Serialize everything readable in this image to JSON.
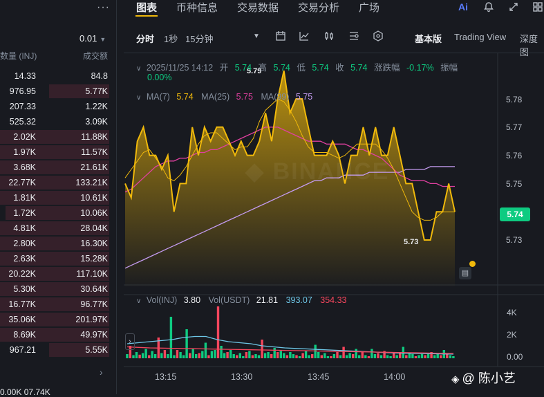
{
  "orderbook": {
    "menu_icon": "more-dots-icon",
    "step_value": "0.01",
    "col_qty": "数量 (INJ)",
    "col_total": "成交额",
    "rows": [
      {
        "q": "14.33",
        "t": "84.8",
        "depth": 0
      },
      {
        "q": "976.95",
        "t": "5.77K",
        "depth": 0.55
      },
      {
        "q": "207.33",
        "t": "1.22K",
        "depth": 0
      },
      {
        "q": "525.32",
        "t": "3.09K",
        "depth": 0
      },
      {
        "q": "2.02K",
        "t": "11.88K",
        "depth": 1
      },
      {
        "q": "1.97K",
        "t": "11.57K",
        "depth": 1
      },
      {
        "q": "3.68K",
        "t": "21.61K",
        "depth": 1
      },
      {
        "q": "22.77K",
        "t": "133.21K",
        "depth": 1
      },
      {
        "q": "1.81K",
        "t": "10.61K",
        "depth": 1
      },
      {
        "q": "1.72K",
        "t": "10.06K",
        "depth": 0.95
      },
      {
        "q": "4.81K",
        "t": "28.04K",
        "depth": 1
      },
      {
        "q": "2.80K",
        "t": "16.30K",
        "depth": 1
      },
      {
        "q": "2.63K",
        "t": "15.28K",
        "depth": 1
      },
      {
        "q": "20.22K",
        "t": "117.10K",
        "depth": 1
      },
      {
        "q": "5.30K",
        "t": "30.64K",
        "depth": 1
      },
      {
        "q": "16.77K",
        "t": "96.77K",
        "depth": 1
      },
      {
        "q": "35.06K",
        "t": "201.97K",
        "depth": 1
      },
      {
        "q": "8.69K",
        "t": "49.97K",
        "depth": 1
      },
      {
        "q": "967.21",
        "t": "5.55K",
        "depth": 0.55
      }
    ],
    "bottom_row": "0.00K    07.74K"
  },
  "tabs": [
    "图表",
    "币种信息",
    "交易数据",
    "交易分析",
    "广场"
  ],
  "active_tab": "图表",
  "top_icons": [
    "ai-icon",
    "bell-icon",
    "expand-icon",
    "layout-icon"
  ],
  "toolbar": {
    "intervals": [
      "分时",
      "1秒",
      "15分钟"
    ],
    "active_interval": "分时",
    "views": [
      "基本版",
      "Trading View",
      "深度图"
    ],
    "active_view": "基本版"
  },
  "ohlc": {
    "datetime": "2025/11/25 14:12",
    "open_label": "开",
    "open": "5.74",
    "high_label": "高",
    "high": "5.74",
    "low_label": "低",
    "low": "5.74",
    "close_label": "收",
    "close": "5.74",
    "change_label": "涨跌幅",
    "change": "-0.17%",
    "amp_label": "振幅",
    "amp": "0.00%"
  },
  "ma": {
    "ma7_label": "MA(7)",
    "ma7": "5.74",
    "ma25_label": "MA(25)",
    "ma25": "5.75",
    "ma99_label": "MA(99)",
    "ma99": "5.75"
  },
  "vol": {
    "inj_label": "Vol(INJ)",
    "inj": "3.80",
    "usdt_label": "Vol(USDT)",
    "usdt": "21.81",
    "ma1": "393.07",
    "ma2": "354.33"
  },
  "colors": {
    "up": "#0ecb81",
    "down": "#f6465d",
    "gold": "#f0b90b",
    "ma25": "#e040a0",
    "ma99": "#c39bf0",
    "bg": "#181a20"
  },
  "chart_data": {
    "type": "area",
    "y_ticks": [
      "5.78",
      "5.77",
      "5.76",
      "5.75",
      "5.73"
    ],
    "current_price": "5.74",
    "high_annotation": "5.79",
    "low_annotation": "5.73",
    "x_ticks": [
      "13:15",
      "13:30",
      "13:45",
      "14:00"
    ],
    "vol_ticks": [
      "4K",
      "2K",
      "0.00"
    ],
    "price_series": [
      5.75,
      5.745,
      5.765,
      5.77,
      5.76,
      5.76,
      5.755,
      5.76,
      5.74,
      5.75,
      5.75,
      5.77,
      5.76,
      5.77,
      5.765,
      5.77,
      5.77,
      5.765,
      5.76,
      5.765,
      5.76,
      5.76,
      5.765,
      5.775,
      5.765,
      5.78,
      5.79,
      5.775,
      5.78,
      5.78,
      5.77,
      5.76,
      5.76,
      5.76,
      5.765,
      5.76,
      5.75,
      5.76,
      5.76,
      5.77,
      5.76,
      5.77,
      5.76,
      5.76,
      5.77,
      5.76,
      5.75,
      5.75,
      5.74,
      5.73,
      5.73,
      5.74,
      5.74,
      5.75,
      5.74
    ],
    "ma7_series": [
      5.752,
      5.755,
      5.758,
      5.761,
      5.762,
      5.759,
      5.756,
      5.752,
      5.751,
      5.753,
      5.756,
      5.76,
      5.764,
      5.767,
      5.768,
      5.768,
      5.766,
      5.764,
      5.762,
      5.763,
      5.763,
      5.766,
      5.772,
      5.776,
      5.778,
      5.78,
      5.779,
      5.776,
      5.772,
      5.767,
      5.763,
      5.761,
      5.761,
      5.761,
      5.76,
      5.759,
      5.76,
      5.762,
      5.764,
      5.764,
      5.764,
      5.764,
      5.762,
      5.759,
      5.755,
      5.75,
      5.745,
      5.74,
      5.738,
      5.737,
      5.737,
      5.738,
      5.74,
      5.74,
      5.74
    ],
    "ma25_series": [
      5.747,
      5.748,
      5.75,
      5.752,
      5.754,
      5.756,
      5.757,
      5.758,
      5.758,
      5.759,
      5.759,
      5.76,
      5.761,
      5.761,
      5.762,
      5.762,
      5.763,
      5.764,
      5.765,
      5.766,
      5.767,
      5.768,
      5.769,
      5.77,
      5.77,
      5.77,
      5.769,
      5.768,
      5.767,
      5.766,
      5.765,
      5.765,
      5.765,
      5.764,
      5.764,
      5.764,
      5.764,
      5.763,
      5.762,
      5.762,
      5.761,
      5.76,
      5.759,
      5.757,
      5.755,
      5.753,
      5.752,
      5.751,
      5.751,
      5.751,
      5.75,
      5.75,
      5.749,
      5.749,
      5.749
    ],
    "ma99_series": [
      5.72,
      5.721,
      5.722,
      5.723,
      5.724,
      5.725,
      5.726,
      5.727,
      5.728,
      5.729,
      5.73,
      5.731,
      5.732,
      5.733,
      5.734,
      5.735,
      5.736,
      5.737,
      5.738,
      5.739,
      5.74,
      5.741,
      5.742,
      5.743,
      5.744,
      5.745,
      5.746,
      5.747,
      5.748,
      5.749,
      5.75,
      5.751,
      5.751,
      5.752,
      5.752,
      5.752,
      5.753,
      5.753,
      5.753,
      5.753,
      5.754,
      5.754,
      5.754,
      5.754,
      5.754,
      5.754,
      5.755,
      5.755,
      5.755,
      5.755,
      5.756,
      5.756,
      5.756,
      5.756,
      5.756
    ],
    "volume": [
      400,
      1200,
      300,
      600,
      350,
      500,
      900,
      300,
      700,
      400,
      2000,
      500,
      800,
      400,
      4000,
      300,
      800,
      600,
      300,
      2800,
      500,
      900,
      400,
      500,
      700,
      1500,
      300,
      700,
      800,
      5000,
      1200,
      500,
      600,
      800,
      400,
      300,
      500,
      200,
      600,
      700,
      300,
      400,
      300,
      1800,
      500,
      600,
      400,
      1000,
      600,
      700,
      500,
      300,
      600,
      400,
      300,
      200,
      500,
      700,
      300,
      400,
      1300,
      600,
      300,
      500,
      200,
      200,
      400,
      600,
      300,
      1100,
      300,
      500,
      400,
      900,
      300,
      600,
      300,
      200,
      900,
      400,
      500,
      300,
      700,
      300,
      200,
      500,
      300,
      600,
      1100,
      300,
      500,
      400,
      200,
      300,
      400,
      300,
      500,
      600,
      300,
      400,
      300,
      800,
      500,
      300,
      200
    ],
    "volume_up": [
      1,
      0,
      1,
      1,
      0,
      1,
      1,
      0,
      1,
      1,
      0,
      1,
      0,
      1,
      1,
      1,
      0,
      1,
      1,
      1,
      0,
      1,
      1,
      0,
      1,
      1,
      0,
      1,
      1,
      0,
      1,
      1,
      0,
      1,
      1,
      0,
      1,
      1,
      0,
      1,
      0,
      1,
      1,
      0,
      1,
      1,
      0,
      1,
      0,
      1,
      1,
      0,
      1,
      1,
      0,
      1,
      0,
      1,
      1,
      0,
      1,
      1,
      0,
      1,
      1,
      0,
      1,
      0,
      1,
      0,
      1,
      1,
      0,
      1,
      1,
      0,
      1,
      0,
      1,
      1,
      0,
      1,
      0,
      1,
      1,
      0,
      1,
      0,
      1,
      0,
      1,
      1,
      0,
      1,
      1,
      0,
      1,
      0,
      1,
      1,
      0,
      1,
      0,
      1,
      1
    ],
    "vol_ma1": [
      1400,
      1500,
      1600,
      1700,
      1800,
      2000,
      2100,
      2100,
      1800,
      1600,
      1500,
      1400,
      1200,
      1100,
      1000,
      950,
      900,
      850,
      800,
      750,
      700,
      650,
      600,
      550,
      500,
      480,
      460,
      440,
      420,
      400
    ],
    "vol_ma2": [
      1100,
      1050,
      1000,
      980,
      960,
      940,
      920,
      900,
      880,
      860,
      840,
      820,
      800,
      780,
      760,
      740,
      720,
      700,
      680,
      660,
      640,
      620,
      600,
      580,
      560,
      540,
      520,
      500,
      480,
      460
    ]
  },
  "watermark": {
    "handle": "@ 陈小艺"
  }
}
